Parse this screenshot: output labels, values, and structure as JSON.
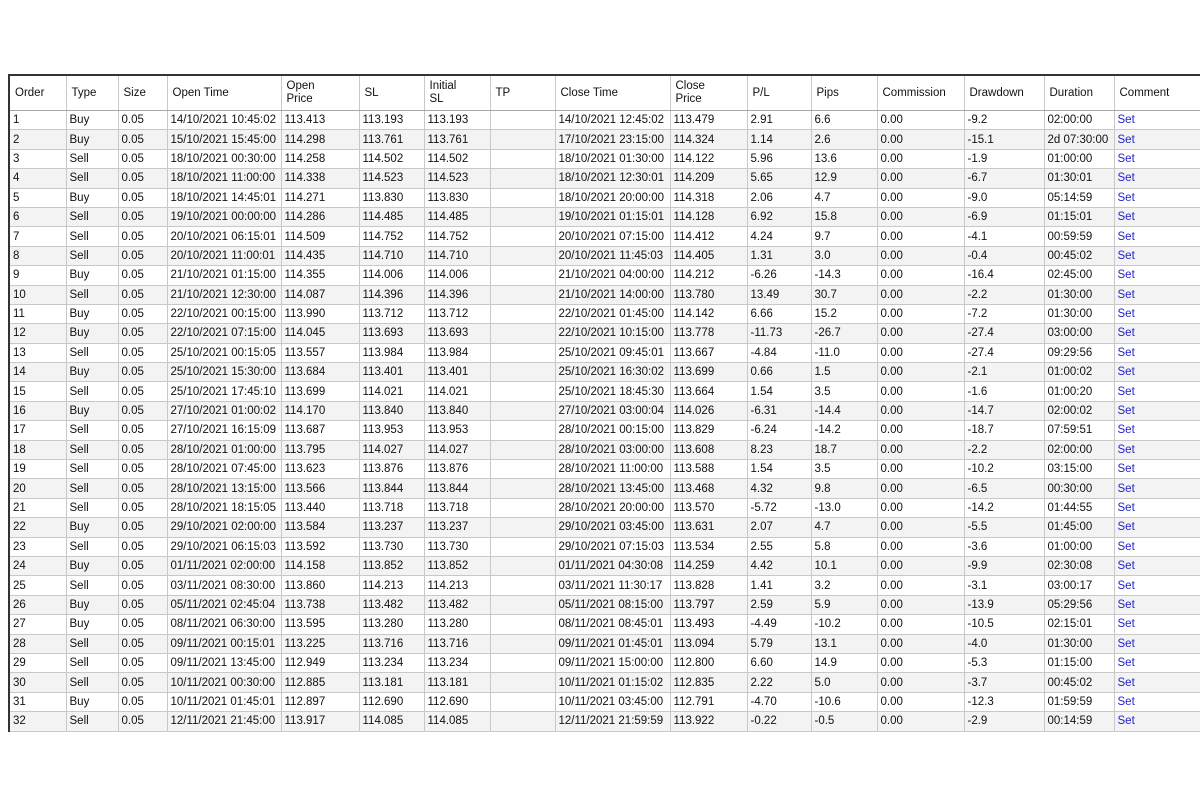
{
  "table": {
    "columns": [
      "Order",
      "Type",
      "Size",
      "Open Time",
      "Open Price",
      "SL",
      "Initial SL",
      "TP",
      "Close Time",
      "Close Price",
      "P/L",
      "Pips",
      "Commission",
      "Drawdown",
      "Duration",
      "Comment"
    ],
    "link_color": "#2222cc",
    "rows": [
      [
        "1",
        "Buy",
        "0.05",
        "14/10/2021 10:45:02",
        "113.413",
        "113.193",
        "113.193",
        "",
        "14/10/2021 12:45:02",
        "113.479",
        "2.91",
        "6.6",
        "0.00",
        "-9.2",
        "02:00:00",
        "Set"
      ],
      [
        "2",
        "Buy",
        "0.05",
        "15/10/2021 15:45:00",
        "114.298",
        "113.761",
        "113.761",
        "",
        "17/10/2021 23:15:00",
        "114.324",
        "1.14",
        "2.6",
        "0.00",
        "-15.1",
        "2d 07:30:00",
        "Set"
      ],
      [
        "3",
        "Sell",
        "0.05",
        "18/10/2021 00:30:00",
        "114.258",
        "114.502",
        "114.502",
        "",
        "18/10/2021 01:30:00",
        "114.122",
        "5.96",
        "13.6",
        "0.00",
        "-1.9",
        "01:00:00",
        "Set"
      ],
      [
        "4",
        "Sell",
        "0.05",
        "18/10/2021 11:00:00",
        "114.338",
        "114.523",
        "114.523",
        "",
        "18/10/2021 12:30:01",
        "114.209",
        "5.65",
        "12.9",
        "0.00",
        "-6.7",
        "01:30:01",
        "Set"
      ],
      [
        "5",
        "Buy",
        "0.05",
        "18/10/2021 14:45:01",
        "114.271",
        "113.830",
        "113.830",
        "",
        "18/10/2021 20:00:00",
        "114.318",
        "2.06",
        "4.7",
        "0.00",
        "-9.0",
        "05:14:59",
        "Set"
      ],
      [
        "6",
        "Sell",
        "0.05",
        "19/10/2021 00:00:00",
        "114.286",
        "114.485",
        "114.485",
        "",
        "19/10/2021 01:15:01",
        "114.128",
        "6.92",
        "15.8",
        "0.00",
        "-6.9",
        "01:15:01",
        "Set"
      ],
      [
        "7",
        "Sell",
        "0.05",
        "20/10/2021 06:15:01",
        "114.509",
        "114.752",
        "114.752",
        "",
        "20/10/2021 07:15:00",
        "114.412",
        "4.24",
        "9.7",
        "0.00",
        "-4.1",
        "00:59:59",
        "Set"
      ],
      [
        "8",
        "Sell",
        "0.05",
        "20/10/2021 11:00:01",
        "114.435",
        "114.710",
        "114.710",
        "",
        "20/10/2021 11:45:03",
        "114.405",
        "1.31",
        "3.0",
        "0.00",
        "-0.4",
        "00:45:02",
        "Set"
      ],
      [
        "9",
        "Buy",
        "0.05",
        "21/10/2021 01:15:00",
        "114.355",
        "114.006",
        "114.006",
        "",
        "21/10/2021 04:00:00",
        "114.212",
        "-6.26",
        "-14.3",
        "0.00",
        "-16.4",
        "02:45:00",
        "Set"
      ],
      [
        "10",
        "Sell",
        "0.05",
        "21/10/2021 12:30:00",
        "114.087",
        "114.396",
        "114.396",
        "",
        "21/10/2021 14:00:00",
        "113.780",
        "13.49",
        "30.7",
        "0.00",
        "-2.2",
        "01:30:00",
        "Set"
      ],
      [
        "11",
        "Buy",
        "0.05",
        "22/10/2021 00:15:00",
        "113.990",
        "113.712",
        "113.712",
        "",
        "22/10/2021 01:45:00",
        "114.142",
        "6.66",
        "15.2",
        "0.00",
        "-7.2",
        "01:30:00",
        "Set"
      ],
      [
        "12",
        "Buy",
        "0.05",
        "22/10/2021 07:15:00",
        "114.045",
        "113.693",
        "113.693",
        "",
        "22/10/2021 10:15:00",
        "113.778",
        "-11.73",
        "-26.7",
        "0.00",
        "-27.4",
        "03:00:00",
        "Set"
      ],
      [
        "13",
        "Sell",
        "0.05",
        "25/10/2021 00:15:05",
        "113.557",
        "113.984",
        "113.984",
        "",
        "25/10/2021 09:45:01",
        "113.667",
        "-4.84",
        "-11.0",
        "0.00",
        "-27.4",
        "09:29:56",
        "Set"
      ],
      [
        "14",
        "Buy",
        "0.05",
        "25/10/2021 15:30:00",
        "113.684",
        "113.401",
        "113.401",
        "",
        "25/10/2021 16:30:02",
        "113.699",
        "0.66",
        "1.5",
        "0.00",
        "-2.1",
        "01:00:02",
        "Set"
      ],
      [
        "15",
        "Sell",
        "0.05",
        "25/10/2021 17:45:10",
        "113.699",
        "114.021",
        "114.021",
        "",
        "25/10/2021 18:45:30",
        "113.664",
        "1.54",
        "3.5",
        "0.00",
        "-1.6",
        "01:00:20",
        "Set"
      ],
      [
        "16",
        "Buy",
        "0.05",
        "27/10/2021 01:00:02",
        "114.170",
        "113.840",
        "113.840",
        "",
        "27/10/2021 03:00:04",
        "114.026",
        "-6.31",
        "-14.4",
        "0.00",
        "-14.7",
        "02:00:02",
        "Set"
      ],
      [
        "17",
        "Sell",
        "0.05",
        "27/10/2021 16:15:09",
        "113.687",
        "113.953",
        "113.953",
        "",
        "28/10/2021 00:15:00",
        "113.829",
        "-6.24",
        "-14.2",
        "0.00",
        "-18.7",
        "07:59:51",
        "Set"
      ],
      [
        "18",
        "Sell",
        "0.05",
        "28/10/2021 01:00:00",
        "113.795",
        "114.027",
        "114.027",
        "",
        "28/10/2021 03:00:00",
        "113.608",
        "8.23",
        "18.7",
        "0.00",
        "-2.2",
        "02:00:00",
        "Set"
      ],
      [
        "19",
        "Sell",
        "0.05",
        "28/10/2021 07:45:00",
        "113.623",
        "113.876",
        "113.876",
        "",
        "28/10/2021 11:00:00",
        "113.588",
        "1.54",
        "3.5",
        "0.00",
        "-10.2",
        "03:15:00",
        "Set"
      ],
      [
        "20",
        "Sell",
        "0.05",
        "28/10/2021 13:15:00",
        "113.566",
        "113.844",
        "113.844",
        "",
        "28/10/2021 13:45:00",
        "113.468",
        "4.32",
        "9.8",
        "0.00",
        "-6.5",
        "00:30:00",
        "Set"
      ],
      [
        "21",
        "Sell",
        "0.05",
        "28/10/2021 18:15:05",
        "113.440",
        "113.718",
        "113.718",
        "",
        "28/10/2021 20:00:00",
        "113.570",
        "-5.72",
        "-13.0",
        "0.00",
        "-14.2",
        "01:44:55",
        "Set"
      ],
      [
        "22",
        "Buy",
        "0.05",
        "29/10/2021 02:00:00",
        "113.584",
        "113.237",
        "113.237",
        "",
        "29/10/2021 03:45:00",
        "113.631",
        "2.07",
        "4.7",
        "0.00",
        "-5.5",
        "01:45:00",
        "Set"
      ],
      [
        "23",
        "Sell",
        "0.05",
        "29/10/2021 06:15:03",
        "113.592",
        "113.730",
        "113.730",
        "",
        "29/10/2021 07:15:03",
        "113.534",
        "2.55",
        "5.8",
        "0.00",
        "-3.6",
        "01:00:00",
        "Set"
      ],
      [
        "24",
        "Buy",
        "0.05",
        "01/11/2021 02:00:00",
        "114.158",
        "113.852",
        "113.852",
        "",
        "01/11/2021 04:30:08",
        "114.259",
        "4.42",
        "10.1",
        "0.00",
        "-9.9",
        "02:30:08",
        "Set"
      ],
      [
        "25",
        "Sell",
        "0.05",
        "03/11/2021 08:30:00",
        "113.860",
        "114.213",
        "114.213",
        "",
        "03/11/2021 11:30:17",
        "113.828",
        "1.41",
        "3.2",
        "0.00",
        "-3.1",
        "03:00:17",
        "Set"
      ],
      [
        "26",
        "Buy",
        "0.05",
        "05/11/2021 02:45:04",
        "113.738",
        "113.482",
        "113.482",
        "",
        "05/11/2021 08:15:00",
        "113.797",
        "2.59",
        "5.9",
        "0.00",
        "-13.9",
        "05:29:56",
        "Set"
      ],
      [
        "27",
        "Buy",
        "0.05",
        "08/11/2021 06:30:00",
        "113.595",
        "113.280",
        "113.280",
        "",
        "08/11/2021 08:45:01",
        "113.493",
        "-4.49",
        "-10.2",
        "0.00",
        "-10.5",
        "02:15:01",
        "Set"
      ],
      [
        "28",
        "Sell",
        "0.05",
        "09/11/2021 00:15:01",
        "113.225",
        "113.716",
        "113.716",
        "",
        "09/11/2021 01:45:01",
        "113.094",
        "5.79",
        "13.1",
        "0.00",
        "-4.0",
        "01:30:00",
        "Set"
      ],
      [
        "29",
        "Sell",
        "0.05",
        "09/11/2021 13:45:00",
        "112.949",
        "113.234",
        "113.234",
        "",
        "09/11/2021 15:00:00",
        "112.800",
        "6.60",
        "14.9",
        "0.00",
        "-5.3",
        "01:15:00",
        "Set"
      ],
      [
        "30",
        "Sell",
        "0.05",
        "10/11/2021 00:30:00",
        "112.885",
        "113.181",
        "113.181",
        "",
        "10/11/2021 01:15:02",
        "112.835",
        "2.22",
        "5.0",
        "0.00",
        "-3.7",
        "00:45:02",
        "Set"
      ],
      [
        "31",
        "Buy",
        "0.05",
        "10/11/2021 01:45:01",
        "112.897",
        "112.690",
        "112.690",
        "",
        "10/11/2021 03:45:00",
        "112.791",
        "-4.70",
        "-10.6",
        "0.00",
        "-12.3",
        "01:59:59",
        "Set"
      ],
      [
        "32",
        "Sell",
        "0.05",
        "12/11/2021 21:45:00",
        "113.917",
        "114.085",
        "114.085",
        "",
        "12/11/2021 21:59:59",
        "113.922",
        "-0.22",
        "-0.5",
        "0.00",
        "-2.9",
        "00:14:59",
        "Set"
      ]
    ]
  }
}
